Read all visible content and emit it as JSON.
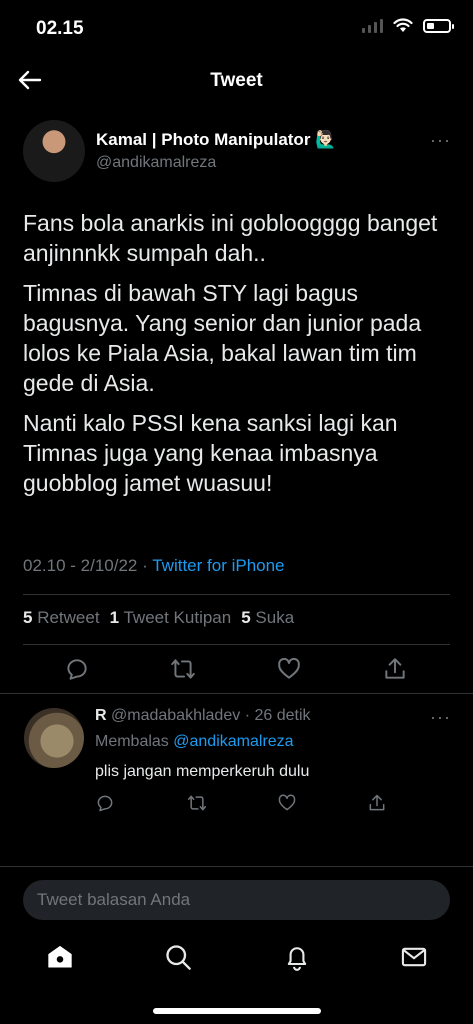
{
  "status_bar": {
    "time": "02.15"
  },
  "header": {
    "title": "Tweet"
  },
  "tweet": {
    "author_name": "Kamal | Photo Manipulator",
    "author_emoji": "🙋🏻‍♂️",
    "author_handle": "@andikamalreza",
    "paragraphs": [
      "Fans bola anarkis ini gobloogggg banget anjinnnkk sumpah dah..",
      "Timnas di bawah STY lagi bagus bagusnya. Yang senior dan junior pada lolos ke Piala Asia, bakal lawan tim tim gede di Asia.",
      "Nanti kalo PSSI kena sanksi lagi kan Timnas juga yang kenaa imbasnya guobblog jamet wuasuu!"
    ],
    "time": "02.10",
    "date": "2/10/22",
    "separator": "·",
    "source": "Twitter for iPhone",
    "retweets_count": "5",
    "retweets_label": "Retweet",
    "quotes_count": "1",
    "quotes_label": "Tweet Kutipan",
    "likes_count": "5",
    "likes_label": "Suka",
    "more": "···"
  },
  "reply": {
    "name": "R",
    "handle": "@madabakhladev",
    "time": "· 26 detik",
    "replying_prefix": "Membalas",
    "replying_to": "@andikamalreza",
    "text": "plis jangan memperkeruh dulu",
    "more": "···"
  },
  "composer": {
    "placeholder": "Tweet balasan Anda"
  },
  "icons": {
    "back": "arrow-left-icon",
    "reply": "comment-icon",
    "retweet": "retweet-icon",
    "like": "heart-icon",
    "share": "share-icon",
    "home": "home-icon",
    "search": "search-icon",
    "notifications": "bell-icon",
    "messages": "mail-icon"
  },
  "colors": {
    "accent": "#1d9bf0",
    "background": "#000000",
    "muted": "#71767b"
  }
}
